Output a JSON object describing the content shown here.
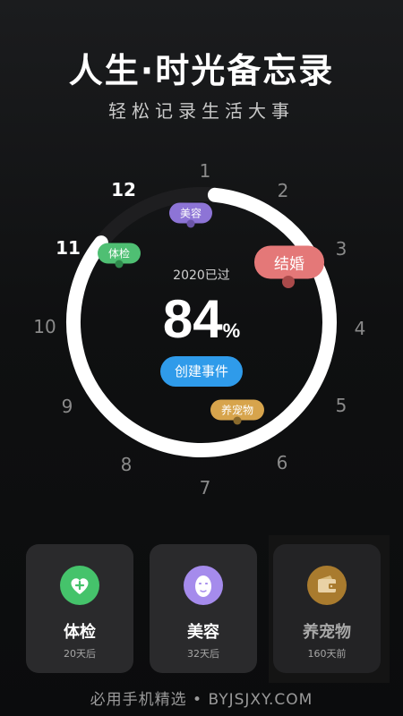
{
  "header": {
    "title": "人生·时光备忘录",
    "subtitle": "轻松记录生活大事"
  },
  "clock": {
    "numbers": [
      "1",
      "2",
      "3",
      "4",
      "5",
      "6",
      "7",
      "8",
      "9",
      "10",
      "11",
      "12"
    ],
    "progress_fraction": 0.84,
    "ring_color": "#ffffff",
    "tags": {
      "beauty": "美容",
      "health": "体检",
      "marry": "结婚",
      "pet": "养宠物"
    },
    "year_label": "2020已过",
    "percent_value": "84",
    "percent_sign": "%",
    "create_button": "创建事件"
  },
  "cards": [
    {
      "name": "体检",
      "sub": "20天后",
      "icon": "heart-plus-icon",
      "color": "#45c36b"
    },
    {
      "name": "美容",
      "sub": "32天后",
      "icon": "face-mask-icon",
      "color": "#a58bec"
    },
    {
      "name": "养宠物",
      "sub": "160天前",
      "icon": "wallet-icon",
      "color": "#c08c35"
    }
  ],
  "footer": {
    "text": "必用手机精选 • BYJSJXY.COM"
  }
}
